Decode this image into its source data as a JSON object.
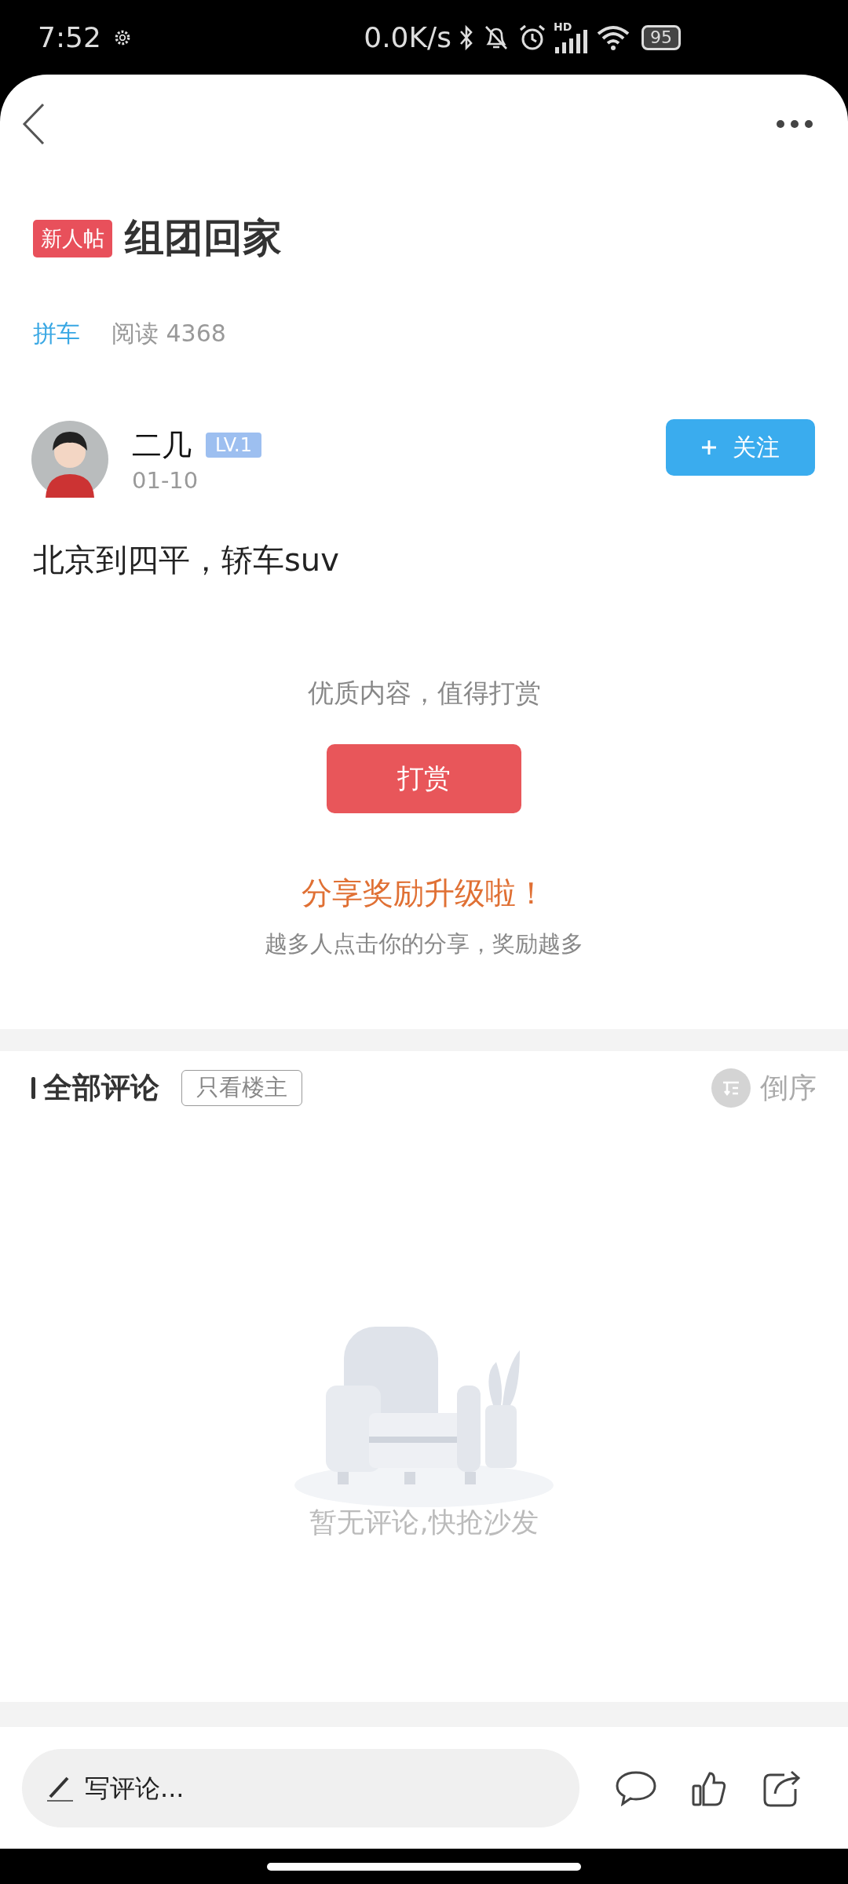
{
  "status_bar": {
    "time": "7:52",
    "speed": "0.0K/s",
    "network": "HD",
    "battery": "95"
  },
  "post": {
    "badge": "新人帖",
    "title": "组团回家",
    "category": "拼车",
    "reads": "阅读 4368"
  },
  "author": {
    "name": "二几",
    "level": "LV.1",
    "date": "01-10",
    "follow_button": "关注"
  },
  "content": "北京到四平，轿车suv",
  "reward": {
    "prompt": "优质内容，值得打赏",
    "button": "打赏",
    "share_title": "分享奖励升级啦！",
    "share_text": "越多人点击你的分享，奖励越多"
  },
  "comments": {
    "title": "全部评论",
    "filter": "只看楼主",
    "filter_selected": false,
    "sort": "倒序",
    "empty_text": "暂无评论,快抢沙发"
  },
  "bottom_bar": {
    "placeholder": "写评论..."
  }
}
